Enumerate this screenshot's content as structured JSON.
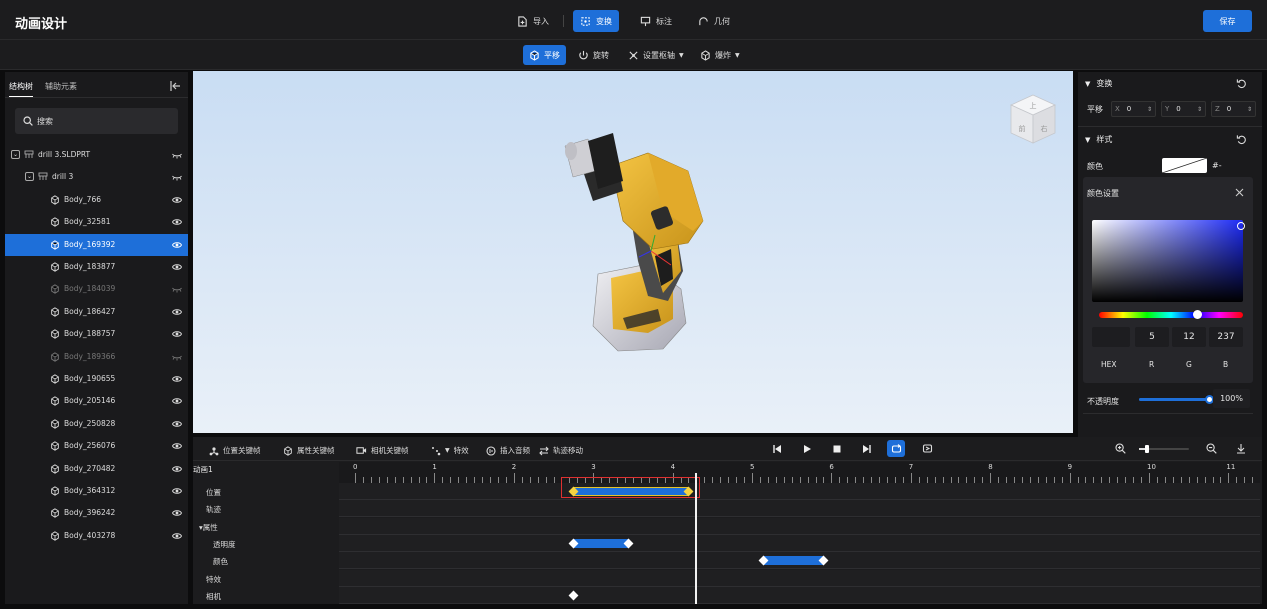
{
  "app": {
    "title": "动画设计",
    "save_label": "保存"
  },
  "topbar": {
    "items": [
      {
        "label": "导入",
        "icon": "import-icon"
      },
      {
        "label": "变换",
        "icon": "transform-icon",
        "active": true
      },
      {
        "label": "标注",
        "icon": "annotation-icon"
      },
      {
        "label": "几何",
        "icon": "geometry-icon"
      }
    ]
  },
  "subbar": {
    "items": [
      {
        "label": "平移",
        "icon": "move-icon",
        "active": true
      },
      {
        "label": "旋转",
        "icon": "rotate-icon"
      },
      {
        "label": "设置枢轴",
        "icon": "pivot-icon",
        "dropdown": true
      },
      {
        "label": "爆炸",
        "icon": "explode-icon",
        "dropdown": true
      }
    ]
  },
  "left": {
    "tabs": [
      {
        "label": "结构树",
        "active": true
      },
      {
        "label": "辅助元素"
      }
    ],
    "search_placeholder": "搜索",
    "tree": [
      {
        "label": "drill 3.SLDPRT",
        "level": 0,
        "type": "assembly",
        "visible": false
      },
      {
        "label": "drill 3",
        "level": 1,
        "type": "assembly",
        "visible": false
      },
      {
        "label": "Body_766",
        "level": 2,
        "visible": true
      },
      {
        "label": "Body_32581",
        "level": 2,
        "visible": true
      },
      {
        "label": "Body_169392",
        "level": 2,
        "visible": true,
        "selected": true
      },
      {
        "label": "Body_183877",
        "level": 2,
        "visible": true
      },
      {
        "label": "Body_184039",
        "level": 2,
        "visible": false
      },
      {
        "label": "Body_186427",
        "level": 2,
        "visible": true
      },
      {
        "label": "Body_188757",
        "level": 2,
        "visible": true
      },
      {
        "label": "Body_189366",
        "level": 2,
        "visible": false
      },
      {
        "label": "Body_190655",
        "level": 2,
        "visible": true
      },
      {
        "label": "Body_205146",
        "level": 2,
        "visible": true
      },
      {
        "label": "Body_250828",
        "level": 2,
        "visible": true
      },
      {
        "label": "Body_256076",
        "level": 2,
        "visible": true
      },
      {
        "label": "Body_270482",
        "level": 2,
        "visible": true
      },
      {
        "label": "Body_364312",
        "level": 2,
        "visible": true
      },
      {
        "label": "Body_396242",
        "level": 2,
        "visible": true
      },
      {
        "label": "Body_403278",
        "level": 2,
        "visible": true
      }
    ]
  },
  "viewcube": {
    "top": "上",
    "front": "前",
    "right": "右"
  },
  "right": {
    "transform": {
      "title": "变换",
      "translate_label": "平移",
      "fields": [
        {
          "axis": "X",
          "value": "0"
        },
        {
          "axis": "Y",
          "value": "0"
        },
        {
          "axis": "Z",
          "value": "0"
        }
      ]
    },
    "style": {
      "title": "样式",
      "color_label": "颜色",
      "color_hex": "#-"
    },
    "color_settings": {
      "title": "颜色设置",
      "values": {
        "hex": "",
        "r": "5",
        "g": "12",
        "b": "237"
      },
      "labels": {
        "hex": "HEX",
        "r": "R",
        "g": "G",
        "b": "B"
      },
      "hue": 0.68
    },
    "opacity": {
      "label": "不透明度",
      "value": "100%",
      "level": 1.0
    }
  },
  "timeline": {
    "tools": [
      {
        "label": "位置关键帧",
        "icon": "position-keyframe-icon"
      },
      {
        "label": "属性关键帧",
        "icon": "property-keyframe-icon"
      },
      {
        "label": "相机关键帧",
        "icon": "camera-keyframe-icon"
      },
      {
        "label": "特效",
        "icon": "effects-icon",
        "dropdown": true
      },
      {
        "label": "插入音频",
        "icon": "audio-icon"
      },
      {
        "label": "轨迹移动",
        "icon": "path-move-icon"
      }
    ],
    "animation_name": "动画1",
    "ruler": [
      "0",
      "1",
      "2",
      "3",
      "4",
      "5",
      "6",
      "7",
      "8",
      "9",
      "10",
      "11"
    ],
    "tracks": [
      {
        "label": "位置",
        "indent": 1
      },
      {
        "label": "轨迹",
        "indent": 1
      },
      {
        "label": "▾属性",
        "indent": 0
      },
      {
        "label": "透明度",
        "indent": 2
      },
      {
        "label": "颜色",
        "indent": 2
      },
      {
        "label": "特效",
        "indent": 1
      },
      {
        "label": "相机",
        "indent": 1
      }
    ],
    "playhead": 4.3,
    "clips": [
      {
        "track": 0,
        "start": 2.75,
        "end": 4.2,
        "selected": true
      },
      {
        "track": 3,
        "start": 2.75,
        "end": 3.45
      },
      {
        "track": 4,
        "start": 5.15,
        "end": 5.9
      }
    ],
    "keyframes": [
      {
        "track": 6,
        "time": 2.75
      }
    ]
  }
}
